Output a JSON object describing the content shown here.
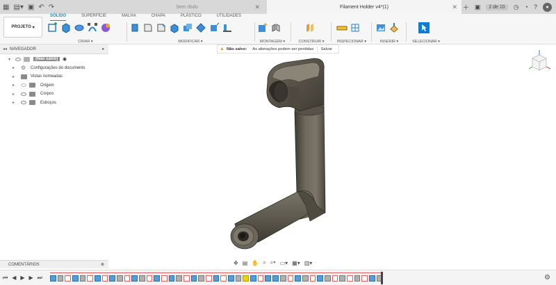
{
  "tabbar": {
    "inactive_tab": "Sem título",
    "active_tab": "Filament Holder v4*(1)",
    "tab_count": "2 de 10"
  },
  "ribbon": {
    "project_label": "PROJETO",
    "tabs": [
      "SÓLIDO",
      "SUPERFÍCIE",
      "MALHA",
      "CHAPA",
      "PLÁSTICO",
      "UTILIDADES"
    ],
    "groups": {
      "criar": "CRIAR ▾",
      "modificar": "MODIFICAR ▾",
      "montagem": "MONTAGEM ▾",
      "construir": "CONSTRUIR ▾",
      "inspecionar": "INSPECIONAR ▾",
      "inserir": "INSERIR ▾",
      "selecionar": "SELECIONAR ▾"
    }
  },
  "navigator": {
    "title": "NAVEGADOR",
    "root": "(Não salvo)",
    "items": [
      {
        "label": "Configurações do documento"
      },
      {
        "label": "Vistas nomeadas"
      },
      {
        "label": "Origem"
      },
      {
        "label": "Corpos"
      },
      {
        "label": "Esboços"
      }
    ]
  },
  "banner": {
    "status": "Não salvo:",
    "message": "As alterações podem ser perdidas",
    "action": "Salvar"
  },
  "comments": {
    "title": "COMENTÁRIOS"
  },
  "colors": {
    "accent": "#0696d7",
    "model": "#5f5a4e",
    "warning": "#e8a000"
  }
}
